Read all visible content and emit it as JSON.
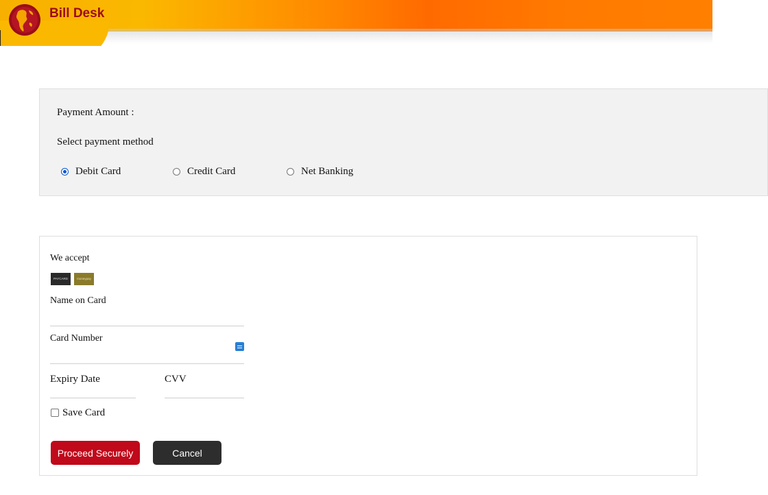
{
  "brand": {
    "title": "Bill Desk",
    "logo_icon": "globe-icon"
  },
  "payment": {
    "amount_label": "Payment Amount :",
    "method_label": "Select payment method",
    "methods": [
      {
        "label": "Debit Card",
        "selected": true
      },
      {
        "label": "Credit Card",
        "selected": false
      },
      {
        "label": "Net Banking",
        "selected": false
      }
    ]
  },
  "card_form": {
    "we_accept": "We accept",
    "accepted_logos": [
      {
        "label": "PAYCARD"
      },
      {
        "label": "moneypay"
      }
    ],
    "name_label": "Name on Card",
    "name_value": "",
    "number_label": "Card Number",
    "number_value": "",
    "number_icon": "card-list-icon",
    "expiry_label": "Expiry Date",
    "cvv_label": "CVV",
    "save_card_label": "Save Card",
    "save_card_checked": false,
    "proceed_label": "Proceed Securely",
    "cancel_label": "Cancel"
  },
  "colors": {
    "brand_red": "#9b0c1a",
    "proceed_button": "#c0091a",
    "cancel_button": "#2d2d2d",
    "radio_selected": "#0b57d0",
    "panel_bg": "#f2f2f2"
  }
}
